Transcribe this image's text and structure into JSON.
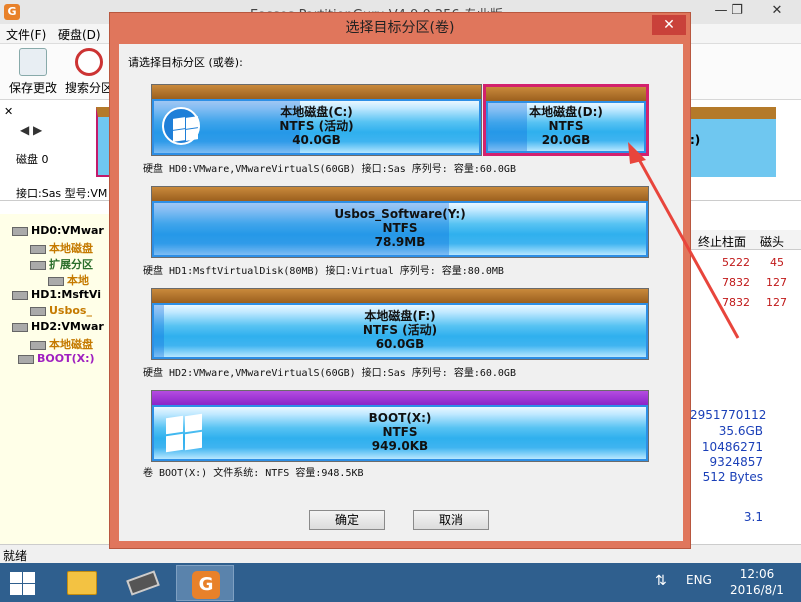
{
  "app": {
    "title": "Eassos PartitionGuru V4.9.0.256 专业版",
    "icon_letter": "G",
    "min": "—",
    "max": "❐",
    "close": "✕",
    "menu": [
      "文件(F)",
      "硬盘(D)"
    ],
    "toolbar": [
      "保存更改",
      "搜索分区"
    ],
    "disk_label": "磁盘 0",
    "disk_info": "接口:Sas 型号:VM",
    "right_part_label": ":)",
    "tree": [
      {
        "label": "HD0:VMwar",
        "color": "#000"
      },
      {
        "label": "本地磁盘",
        "color": "#c57a00"
      },
      {
        "label": "扩展分区",
        "color": "#2a6e2a"
      },
      {
        "label": "本地",
        "color": "#c57a00"
      },
      {
        "label": "HD1:MsftVi",
        "color": "#000"
      },
      {
        "label": "Usbos_",
        "color": "#c57a00"
      },
      {
        "label": "HD2:VMwar",
        "color": "#000"
      },
      {
        "label": "本地磁盘",
        "color": "#c57a00"
      },
      {
        "label": "BOOT(X:)",
        "color": "#a020c0"
      }
    ],
    "grid": {
      "headers": [
        "终止柱面",
        "磁头"
      ],
      "rows": [
        [
          "5222",
          "45"
        ],
        [
          "7832",
          "127"
        ],
        [
          "7832",
          "127"
        ]
      ]
    },
    "info_values": [
      "2951770112",
      "35.6GB",
      "10486271",
      "9324857",
      "512 Bytes",
      "3.1"
    ],
    "status": "就绪"
  },
  "dialog": {
    "title": "选择目标分区(卷)",
    "close": "✕",
    "prompt": "请选择目标分区 (或卷):",
    "disks": [
      {
        "info": "硬盘 HD0:VMware,VMwareVirtualS(60GB)   接口:Sas  序列号:   容量:60.0GB",
        "partitions": [
          {
            "name": "本地磁盘(C:)",
            "fs": "NTFS (活动)",
            "size": "40.0GB",
            "used": 0.45,
            "logo": "round",
            "cap": "brown",
            "selected": false
          },
          {
            "name": "本地磁盘(D:)",
            "fs": "NTFS",
            "size": "20.0GB",
            "used": 0.25,
            "logo": "",
            "cap": "brown",
            "selected": true
          }
        ]
      },
      {
        "info": "硬盘 HD1:MsftVirtualDisk(80MB)   接口:Virtual  序列号:   容量:80.0MB",
        "partitions": [
          {
            "name": "Usbos_Software(Y:)",
            "fs": "NTFS",
            "size": "78.9MB",
            "used": 0.6,
            "logo": "",
            "cap": "brown",
            "selected": false
          }
        ]
      },
      {
        "info": "硬盘 HD2:VMware,VMwareVirtualS(60GB)   接口:Sas  序列号:   容量:60.0GB",
        "partitions": [
          {
            "name": "本地磁盘(F:)",
            "fs": "NTFS (活动)",
            "size": "60.0GB",
            "used": 0.02,
            "logo": "",
            "cap": "brown",
            "selected": false
          }
        ]
      },
      {
        "info": "卷 BOOT(X:)   文件系统: NTFS  容量:948.5KB",
        "partitions": [
          {
            "name": "BOOT(X:)",
            "fs": "NTFS",
            "size": "949.0KB",
            "used": 0.0,
            "logo": "flat",
            "cap": "purple",
            "selected": false
          }
        ]
      }
    ],
    "ok_label": "确定",
    "cancel_label": "取消"
  },
  "taskbar": {
    "lang": "ENG",
    "time": "12:06",
    "date": "2016/8/1"
  },
  "colors": {
    "accent_selected": "#d3216e",
    "arrow": "#e8453c",
    "dialog_frame": "#e0765c"
  }
}
